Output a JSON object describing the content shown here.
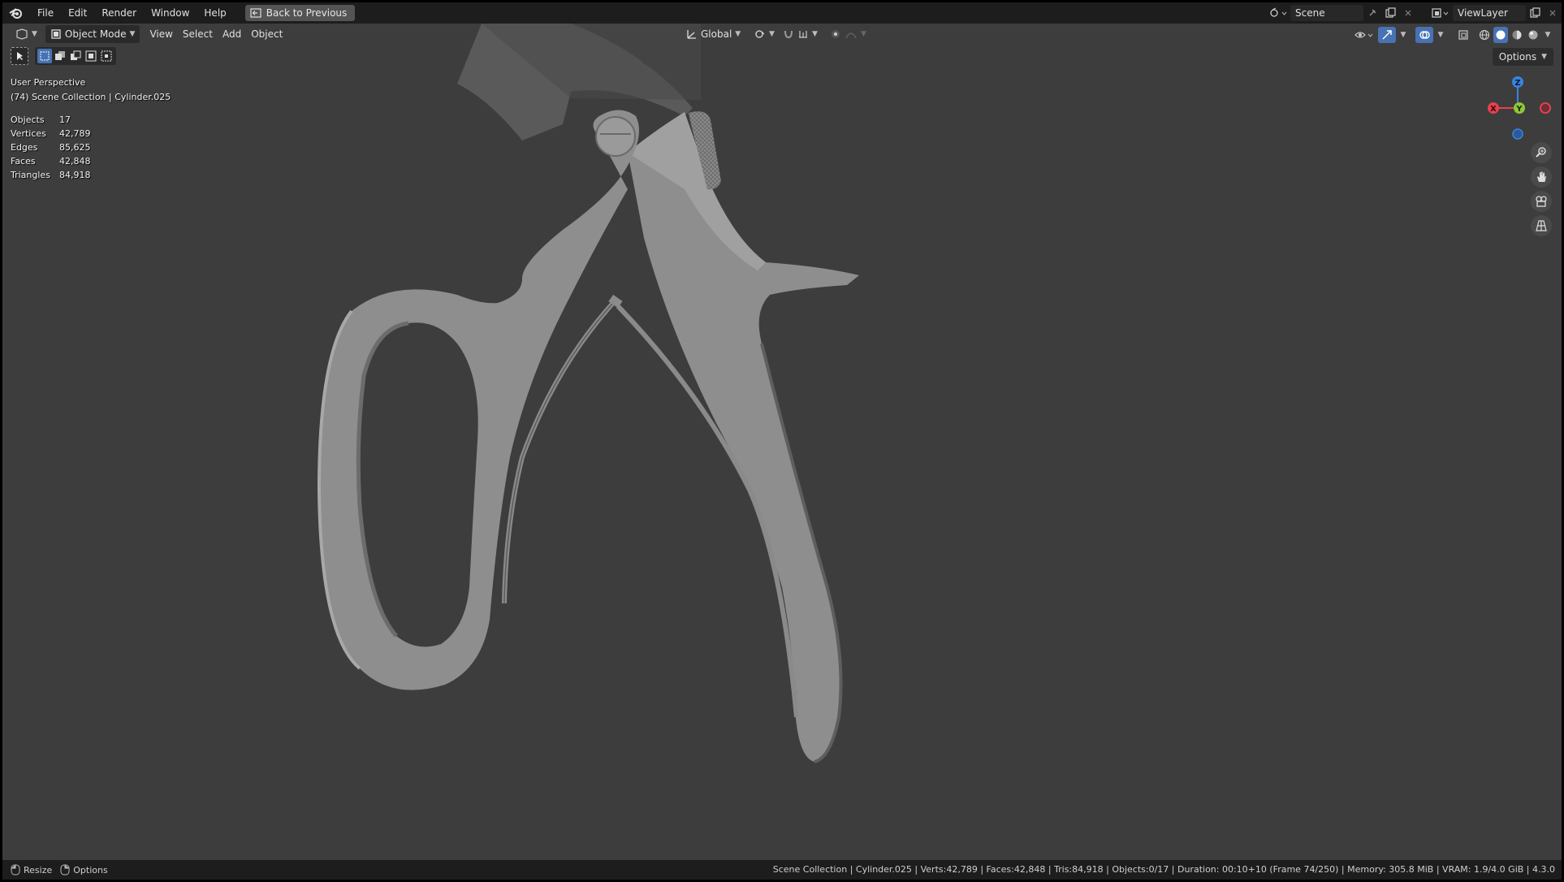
{
  "topbar": {
    "menus": [
      "File",
      "Edit",
      "Render",
      "Window",
      "Help"
    ],
    "back_button": "Back to Previous",
    "scene_name": "Scene",
    "view_layer": "ViewLayer"
  },
  "viewport_header": {
    "mode": "Object Mode",
    "menus": [
      "View",
      "Select",
      "Add",
      "Object"
    ],
    "orientation": "Global"
  },
  "overlay": {
    "perspective": "User Perspective",
    "collection": "(74) Scene Collection | Cylinder.025",
    "stats": [
      {
        "label": "Objects",
        "value": "17"
      },
      {
        "label": "Vertices",
        "value": "42,789"
      },
      {
        "label": "Edges",
        "value": "85,625"
      },
      {
        "label": "Faces",
        "value": "42,848"
      },
      {
        "label": "Triangles",
        "value": "84,918"
      }
    ]
  },
  "options_label": "Options",
  "gizmo": {
    "x": "X",
    "y": "Y",
    "z": "Z"
  },
  "statusbar": {
    "left": [
      {
        "label": "Resize"
      },
      {
        "label": "Options"
      }
    ],
    "right": "Scene Collection | Cylinder.025 | Verts:42,789 | Faces:42,848 | Tris:84,918 | Objects:0/17 | Duration: 00:10+10 (Frame 74/250) | Memory: 305.8 MiB | VRAM: 1.9/4.0 GiB | 4.3.0"
  },
  "colors": {
    "background": "#3d3d3d",
    "header": "#1d1d1d",
    "axis_x": "#e8404f",
    "axis_y": "#8cc83a",
    "axis_z": "#3a83e0",
    "accent": "#4772b3"
  }
}
